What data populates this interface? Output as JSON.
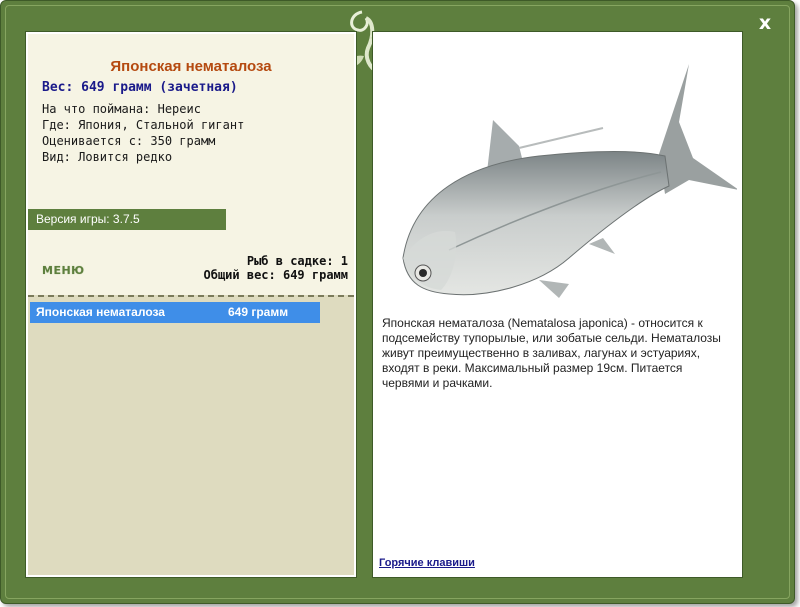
{
  "window": {
    "close_label": "x"
  },
  "fish": {
    "name": "Японская нематалоза",
    "weight_line": "Вес: 649 грамм (зачетная)",
    "info": [
      "На что поймана: Нереис",
      "Где: Япония, Стальной гигант",
      "Оценивается с: 350 грамм",
      "Вид: Ловится редко"
    ]
  },
  "version": "Версия игры: 3.7.5",
  "menu_label": "МЕНЮ",
  "keep_net": {
    "count": "Рыб в садке: 1",
    "total": "Общий вес: 649 грамм",
    "rows": [
      {
        "name": "Японская нематалоза",
        "weight": "649 грамм",
        "selected": true
      }
    ]
  },
  "description": "Японская нематалоза (Nematalosa japonica) - относится к подсемейству тупорылые, или зобатые сельди. Нематалозы живут преимущественно в заливах, лагунах и эстуариях, входят в реки. Максимальный размер 19см. Питается червями и рачками.",
  "hotkeys_label": "Горячие клавиши",
  "colors": {
    "frame": "#5e7f3e",
    "selection": "#3f8ee8",
    "fish_name": "#b54a10",
    "weight_text": "#1a1a8a"
  },
  "icons": {
    "close": "close-icon",
    "ornament": "leaf-ornament-icon",
    "fish": "fish-illustration"
  }
}
